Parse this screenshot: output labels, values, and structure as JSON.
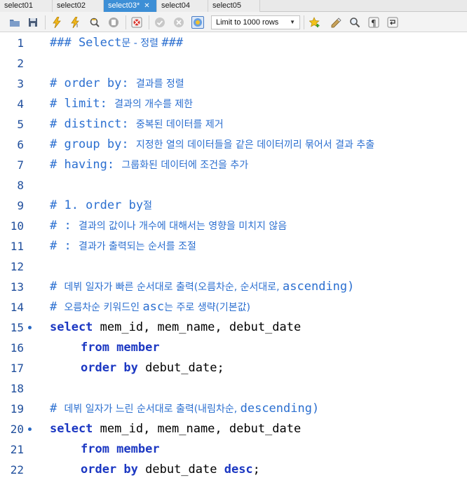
{
  "tabs": [
    {
      "label": "select01",
      "active": false
    },
    {
      "label": "select02",
      "active": false
    },
    {
      "label": "select03*",
      "active": true,
      "close": "✕"
    },
    {
      "label": "select04",
      "active": false
    },
    {
      "label": "select05",
      "active": false
    }
  ],
  "toolbar": {
    "limit_label": "Limit to 1000 rows",
    "icons": [
      "folder-icon",
      "save-icon",
      "execute-icon",
      "execute-current-icon",
      "explain-icon",
      "stop-icon",
      "toggle-error-icon",
      "commit-icon",
      "rollback-icon",
      "autocommit-icon",
      "bookmark-icon",
      "beautify-icon",
      "find-icon",
      "invisible-chars-icon",
      "wrap-icon"
    ]
  },
  "colors": {
    "accent_tab": "#3d8fd6",
    "keyword": "#1b37c2",
    "comment": "#2b6fd0"
  },
  "editor": {
    "lines": [
      {
        "n": "1",
        "parts": [
          {
            "t": "### Select",
            "c": "hdr"
          },
          {
            "t": "문 - 정렬 ",
            "c": "hdr ko"
          },
          {
            "t": "###",
            "c": "hdr"
          }
        ]
      },
      {
        "n": "2",
        "parts": []
      },
      {
        "n": "3",
        "parts": [
          {
            "t": "# order by: ",
            "c": "comment"
          },
          {
            "t": "결과를 정렬",
            "c": "comment ko"
          }
        ]
      },
      {
        "n": "4",
        "parts": [
          {
            "t": "# limit: ",
            "c": "comment"
          },
          {
            "t": "결과의 개수를 제한",
            "c": "comment ko"
          }
        ]
      },
      {
        "n": "5",
        "parts": [
          {
            "t": "# distinct: ",
            "c": "comment"
          },
          {
            "t": "중복된 데이터를 제거",
            "c": "comment ko"
          }
        ]
      },
      {
        "n": "6",
        "parts": [
          {
            "t": "# group by: ",
            "c": "comment"
          },
          {
            "t": "지정한 열의 데이터들을 같은 데이터끼리 묶어서 결과 추출",
            "c": "comment ko"
          }
        ]
      },
      {
        "n": "7",
        "parts": [
          {
            "t": "# having: ",
            "c": "comment"
          },
          {
            "t": "그룹화된 데이터에 조건을 추가",
            "c": "comment ko"
          }
        ]
      },
      {
        "n": "8",
        "parts": []
      },
      {
        "n": "9",
        "parts": [
          {
            "t": "# 1. order by",
            "c": "comment"
          },
          {
            "t": "절",
            "c": "comment ko"
          }
        ]
      },
      {
        "n": "10",
        "parts": [
          {
            "t": "# : ",
            "c": "comment"
          },
          {
            "t": "결과의 값이나 개수에 대해서는 영향을 미치지 않음",
            "c": "comment ko"
          }
        ]
      },
      {
        "n": "11",
        "parts": [
          {
            "t": "# : ",
            "c": "comment"
          },
          {
            "t": "결과가 출력되는 순서를 조절",
            "c": "comment ko"
          }
        ]
      },
      {
        "n": "12",
        "parts": []
      },
      {
        "n": "13",
        "parts": [
          {
            "t": "# ",
            "c": "comment"
          },
          {
            "t": "데뷔 일자가 빠른 순서대로 출력(오름차순, 순서대로, ",
            "c": "comment ko"
          },
          {
            "t": "ascending)",
            "c": "comment"
          }
        ]
      },
      {
        "n": "14",
        "parts": [
          {
            "t": "# ",
            "c": "comment"
          },
          {
            "t": "오름차순 키워드인 ",
            "c": "comment ko"
          },
          {
            "t": "asc",
            "c": "comment"
          },
          {
            "t": "는 주로 생략(기본값)",
            "c": "comment ko"
          }
        ]
      },
      {
        "n": "15",
        "dot": true,
        "parts": [
          {
            "t": "select",
            "c": "kw"
          },
          {
            "t": " mem_id, mem_name, debut_date",
            "c": "id"
          }
        ]
      },
      {
        "n": "16",
        "indent": true,
        "parts": [
          {
            "t": "from member",
            "c": "kw"
          }
        ]
      },
      {
        "n": "17",
        "indent": true,
        "parts": [
          {
            "t": "order by",
            "c": "kw"
          },
          {
            "t": " debut_date;",
            "c": "id"
          }
        ]
      },
      {
        "n": "18",
        "parts": []
      },
      {
        "n": "19",
        "parts": [
          {
            "t": "# ",
            "c": "comment"
          },
          {
            "t": "데뷔 일자가 느린 순서대로 출력(내림차순, ",
            "c": "comment ko"
          },
          {
            "t": "descending)",
            "c": "comment"
          }
        ]
      },
      {
        "n": "20",
        "dot": true,
        "parts": [
          {
            "t": "select",
            "c": "kw"
          },
          {
            "t": " mem_id, mem_name, debut_date",
            "c": "id"
          }
        ]
      },
      {
        "n": "21",
        "indent": true,
        "parts": [
          {
            "t": "from member",
            "c": "kw"
          }
        ]
      },
      {
        "n": "22",
        "indent": true,
        "parts": [
          {
            "t": "order by",
            "c": "kw"
          },
          {
            "t": " debut_date ",
            "c": "id"
          },
          {
            "t": "desc",
            "c": "kw"
          },
          {
            "t": ";",
            "c": "id"
          }
        ]
      }
    ]
  }
}
